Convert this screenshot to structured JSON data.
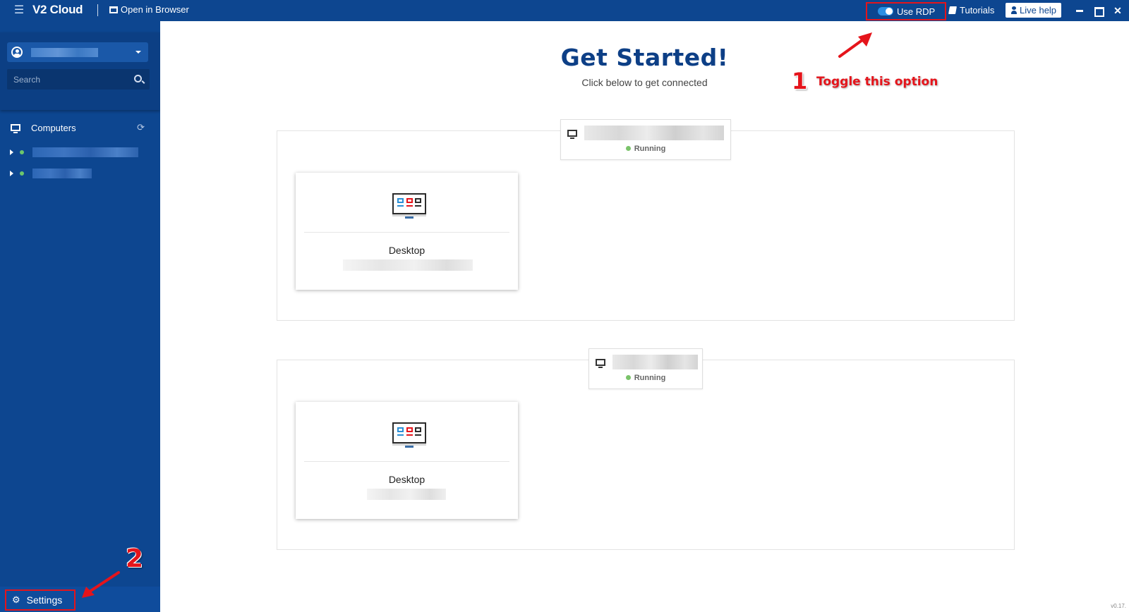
{
  "topbar": {
    "brand": "V2 Cloud",
    "open_in_browser": "Open in Browser",
    "use_rdp": "Use RDP",
    "tutorials": "Tutorials",
    "live_help": "Live help",
    "use_rdp_enabled": true
  },
  "sidebar": {
    "search_placeholder": "Search",
    "computers_label": "Computers",
    "settings_label": "Settings"
  },
  "main": {
    "title": "Get Started!",
    "subtitle": "Click below to get connected",
    "groups": [
      {
        "status": "Running",
        "card_label": "Desktop"
      },
      {
        "status": "Running",
        "card_label": "Desktop"
      }
    ]
  },
  "annotations": {
    "step1_number": "1",
    "step1_text": "Toggle this option",
    "step2_number": "2",
    "color": "#e5141b"
  },
  "footer": {
    "version": "v0.17."
  },
  "colors": {
    "brand_blue": "#0d4690",
    "title_blue": "#0d3f86",
    "running_green": "#7ac36a"
  }
}
